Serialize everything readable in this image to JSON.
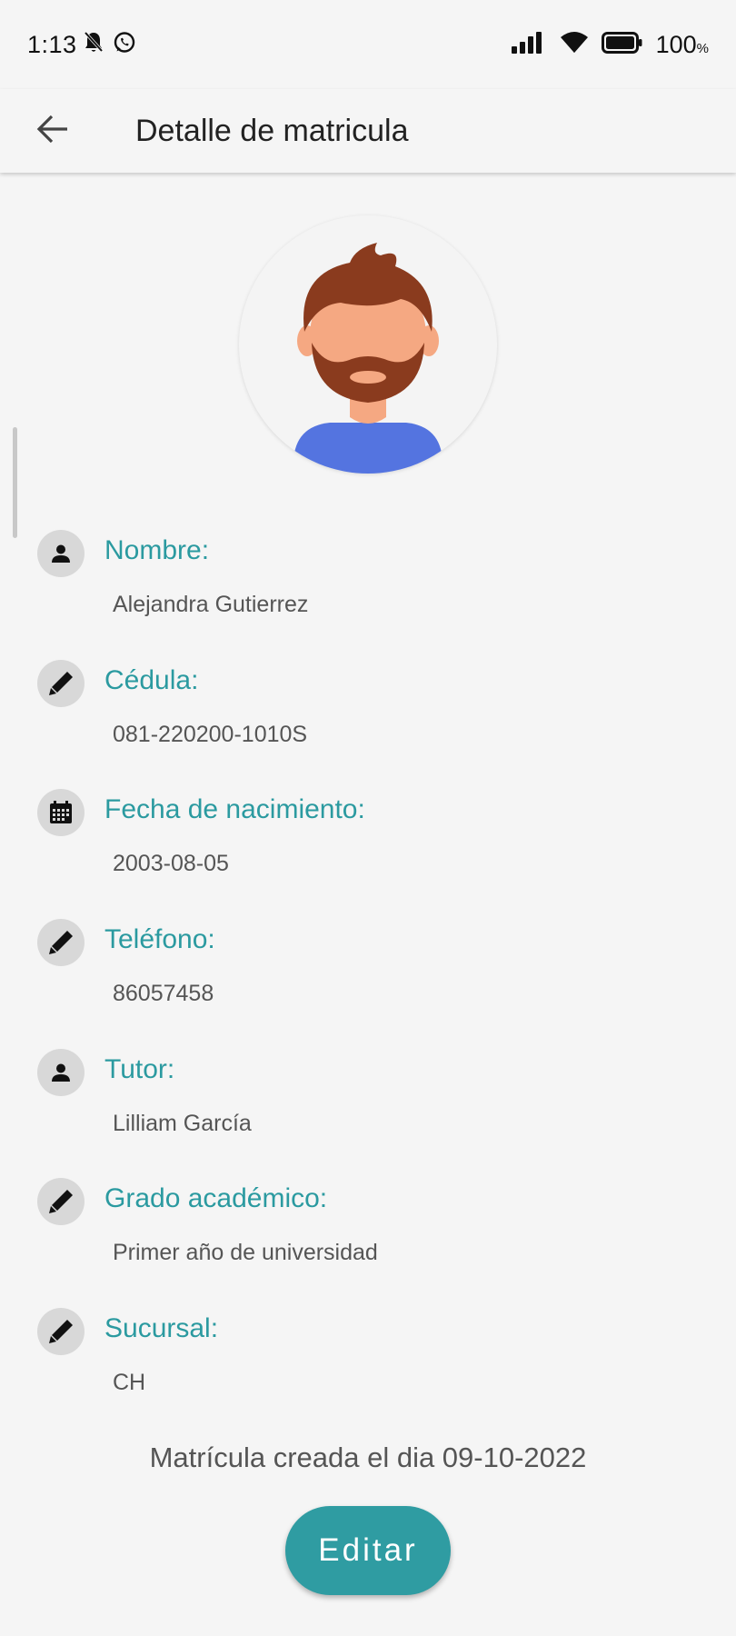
{
  "status_bar": {
    "time": "1:13",
    "left_icons": [
      "bell-off-icon",
      "whatsapp-icon"
    ],
    "right_icons": [
      "signal-icon",
      "wifi-icon",
      "battery-icon"
    ],
    "battery_value": "100",
    "battery_unit": "%"
  },
  "app_bar": {
    "back_icon": "arrow-left-icon",
    "title": "Detalle de matricula"
  },
  "avatar": {
    "icon": "user-avatar-bearded-man"
  },
  "details": [
    {
      "icon": "person-icon",
      "label": "Nombre:",
      "value": "Alejandra Gutierrez"
    },
    {
      "icon": "pencil-icon",
      "label": "Cédula:",
      "value": "081-220200-1010S"
    },
    {
      "icon": "calendar-icon",
      "label": "Fecha de nacimiento:",
      "value": "2003-08-05"
    },
    {
      "icon": "pencil-icon",
      "label": "Teléfono:",
      "value": "86057458"
    },
    {
      "icon": "person-icon",
      "label": "Tutor:",
      "value": "Lilliam García"
    },
    {
      "icon": "pencil-icon",
      "label": "Grado académico:",
      "value": "Primer año de universidad"
    },
    {
      "icon": "pencil-icon",
      "label": "Sucursal:",
      "value": "CH"
    }
  ],
  "footer": {
    "created_text": "Matrícula creada el dia 09-10-2022",
    "edit_button_label": "Editar"
  },
  "colors": {
    "accent": "#2b9aa0",
    "button": "#2f9ca2",
    "background": "#f5f5f5",
    "icon_circle": "#d8d8d8"
  }
}
